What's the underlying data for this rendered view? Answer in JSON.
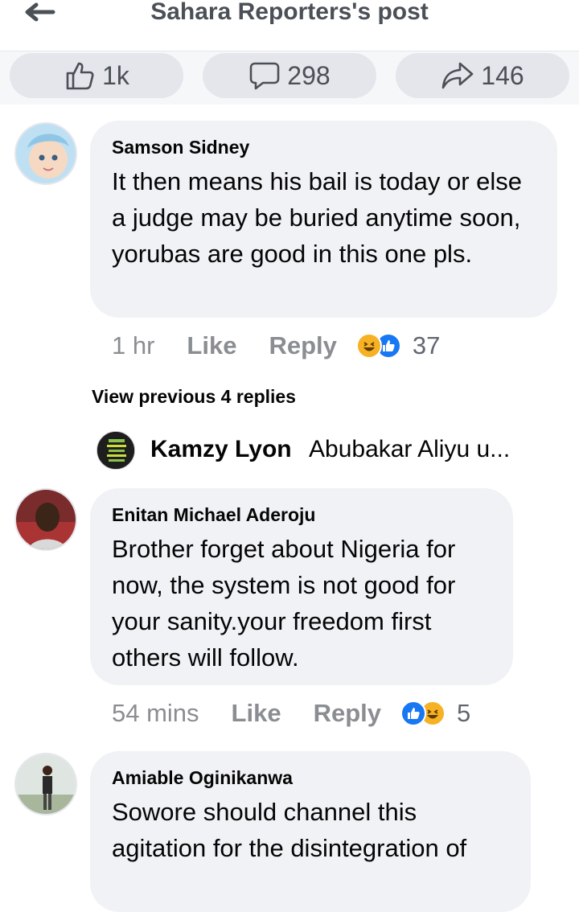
{
  "header": {
    "title": "Sahara Reporters's post",
    "back_icon": "arrow-left-icon"
  },
  "actions": {
    "likes": "1k",
    "comments": "298",
    "shares": "146"
  },
  "comments": [
    {
      "author": "Samson Sidney",
      "text": "It then means his bail is today or else a judge may be buried anytime soon, yorubas are good in this one pls.",
      "time": "1 hr",
      "like_label": "Like",
      "reply_label": "Reply",
      "reaction_count": "37",
      "reactions": [
        "haha",
        "like"
      ]
    },
    {
      "author": "Enitan Michael Aderoju",
      "text": "Brother forget about Nigeria for now, the system is not good for your sanity.your freedom first others will follow.",
      "time": "54 mins",
      "like_label": "Like",
      "reply_label": "Reply",
      "reaction_count": "5",
      "reactions": [
        "like",
        "haha"
      ]
    },
    {
      "author": "Amiable Oginikanwa",
      "text": "Sowore should channel this agitation for the disintegration of"
    }
  ],
  "replies": {
    "view_previous": "View previous 4 replies",
    "latest_author": "Kamzy Lyon",
    "latest_text": "Abubakar Aliyu u..."
  },
  "colors": {
    "bubble": "#f0f2f5",
    "muted_text": "#8a8d91",
    "like_blue": "#1877f2",
    "haha_yellow": "#f7b125"
  }
}
